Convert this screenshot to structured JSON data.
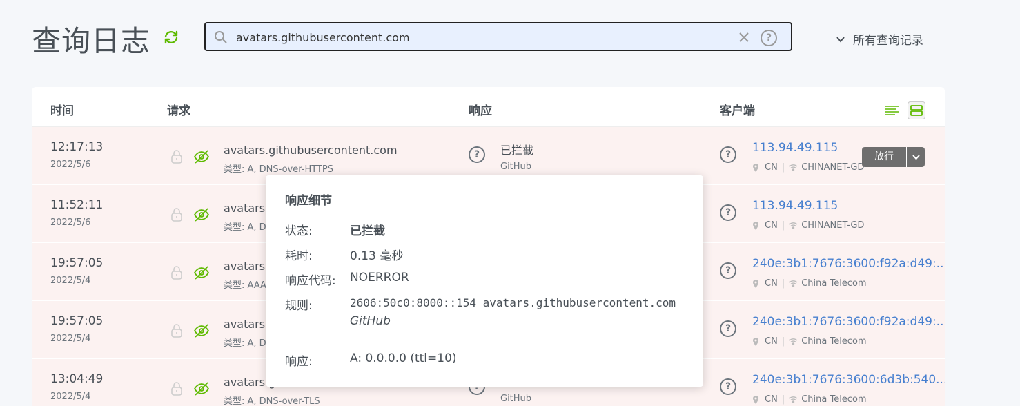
{
  "page": {
    "title": "查询日志",
    "search_value": "avatars.githubusercontent.com",
    "filter_label": "所有查询记录"
  },
  "table": {
    "headers": {
      "time": "时间",
      "request": "请求",
      "response": "响应",
      "client": "客户端"
    },
    "rows": [
      {
        "time": "12:17:13",
        "date": "2022/5/6",
        "domain": "avatars.githubusercontent.com",
        "type": "类型: A, DNS-over-HTTPS",
        "response": "已拦截",
        "response_sub": "GitHub",
        "ip": "113.94.49.115",
        "country": "CN",
        "network": "CHINANET-GD",
        "action": "放行"
      },
      {
        "time": "11:52:11",
        "date": "2022/5/6",
        "domain": "avatars.g",
        "type": "类型: A, D",
        "response": "",
        "response_sub": "",
        "ip": "113.94.49.115",
        "country": "CN",
        "network": "CHINANET-GD"
      },
      {
        "time": "19:57:05",
        "date": "2022/5/4",
        "domain": "avatars.g",
        "type": "类型: AAA",
        "response": "",
        "response_sub": "",
        "ip": "240e:3b1:7676:3600:f92a:d49:...",
        "country": "CN",
        "network": "China Telecom"
      },
      {
        "time": "19:57:05",
        "date": "2022/5/4",
        "domain": "avatars.g",
        "type": "类型: A, D",
        "response": "",
        "response_sub": "",
        "ip": "240e:3b1:7676:3600:f92a:d49:...",
        "country": "CN",
        "network": "China Telecom"
      },
      {
        "time": "13:04:49",
        "date": "2022/5/4",
        "domain": "avatars.githubusercontent.com",
        "type": "类型: A, DNS-over-TLS",
        "response": "",
        "response_sub": "GitHub",
        "ip": "240e:3b1:7676:3600:6d3b:540...",
        "country": "CN",
        "network": "China Telecom"
      }
    ]
  },
  "popover": {
    "title": "响应细节",
    "status_label": "状态:",
    "status_value": "已拦截",
    "elapsed_label": "耗时:",
    "elapsed_value": "0.13 毫秒",
    "code_label": "响应代码:",
    "code_value": "NOERROR",
    "rule_label": "规则:",
    "rule_value": "2606:50c0:8000::154 avatars.githubusercontent.com",
    "rule_source": "GitHub",
    "answer_label": "响应:",
    "answer_value": "A: 0.0.0.0 (ttl=10)"
  },
  "colors": {
    "accent_green": "#5eba00",
    "link_blue": "#467fcf",
    "row_blocked_bg": "#fcf2f1"
  },
  "icons": [
    "refresh-icon",
    "search-icon",
    "clear-icon",
    "help-icon",
    "chevron-down-icon",
    "compact-view-icon",
    "detailed-view-icon",
    "lock-icon",
    "eye-off-icon",
    "question-icon",
    "location-pin-icon",
    "wifi-icon"
  ]
}
